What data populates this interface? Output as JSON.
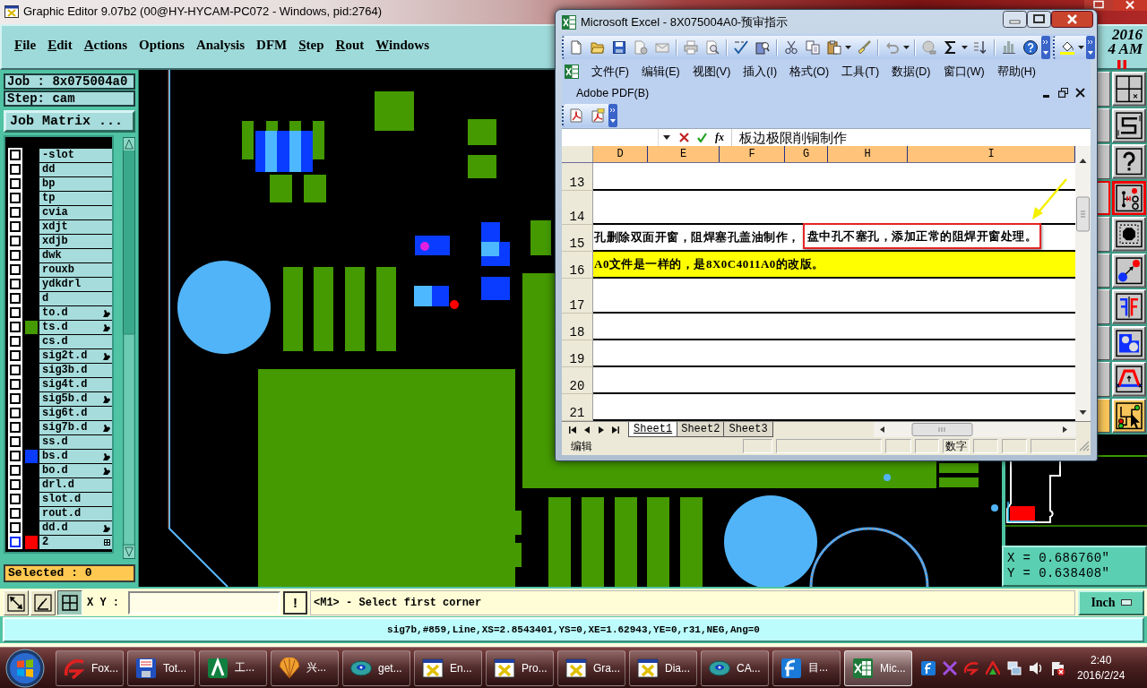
{
  "editor_window": {
    "title": "Graphic Editor 9.07b2 (00@HY-HYCAM-PC072 - Windows, pid:2764)",
    "menu": [
      {
        "label": "File",
        "mnemonic": true
      },
      {
        "label": "Edit",
        "mnemonic": true
      },
      {
        "label": "Actions",
        "mnemonic": true
      },
      {
        "label": "Options",
        "mnemonic": false
      },
      {
        "label": "Analysis",
        "mnemonic": false
      },
      {
        "label": "DFM",
        "mnemonic": false
      },
      {
        "label": "Step",
        "mnemonic": true
      },
      {
        "label": "Rout",
        "mnemonic": true
      },
      {
        "label": "Windows",
        "mnemonic": true
      }
    ],
    "clock": {
      "year": "2016",
      "time": "4 AM"
    },
    "job": "Job : 8x075004a0",
    "step": "Step: cam",
    "job_matrix_button": "Job Matrix ...",
    "layers": [
      {
        "name": "-slot",
        "checked": false,
        "marked": false,
        "current": false
      },
      {
        "name": "dd",
        "checked": false,
        "marked": false,
        "current": false
      },
      {
        "name": "bp",
        "checked": false,
        "marked": false,
        "current": false
      },
      {
        "name": "tp",
        "checked": false,
        "marked": false,
        "current": false
      },
      {
        "name": "cvia",
        "checked": false,
        "marked": false,
        "current": false
      },
      {
        "name": "xdjt",
        "checked": false,
        "marked": false,
        "current": false
      },
      {
        "name": "xdjb",
        "checked": false,
        "marked": false,
        "current": false
      },
      {
        "name": "dwk",
        "checked": false,
        "marked": false,
        "current": false
      },
      {
        "name": "rouxb",
        "checked": false,
        "marked": false,
        "current": false
      },
      {
        "name": "ydkdrl",
        "checked": false,
        "marked": false,
        "current": false
      },
      {
        "name": "d",
        "checked": false,
        "marked": false,
        "current": false
      },
      {
        "name": "to.d",
        "checked": false,
        "marked": true,
        "current": false
      },
      {
        "name": "ts.d",
        "checked": false,
        "marked": true,
        "current": false,
        "color": "#449a00"
      },
      {
        "name": "cs.d",
        "checked": false,
        "marked": false,
        "current": false
      },
      {
        "name": "sig2t.d",
        "checked": false,
        "marked": true,
        "current": false
      },
      {
        "name": "sig3b.d",
        "checked": false,
        "marked": false,
        "current": false
      },
      {
        "name": "sig4t.d",
        "checked": false,
        "marked": false,
        "current": false
      },
      {
        "name": "sig5b.d",
        "checked": false,
        "marked": true,
        "current": false
      },
      {
        "name": "sig6t.d",
        "checked": false,
        "marked": false,
        "current": false
      },
      {
        "name": "sig7b.d",
        "checked": false,
        "marked": true,
        "current": false
      },
      {
        "name": "ss.d",
        "checked": false,
        "marked": false,
        "current": false
      },
      {
        "name": "bs.d",
        "checked": false,
        "marked": true,
        "current": false,
        "color": "#0a3cff"
      },
      {
        "name": "bo.d",
        "checked": false,
        "marked": true,
        "current": false
      },
      {
        "name": "drl.d",
        "checked": false,
        "marked": false,
        "current": false
      },
      {
        "name": "slot.d",
        "checked": false,
        "marked": false,
        "current": false
      },
      {
        "name": "rout.d",
        "checked": false,
        "marked": false,
        "current": false
      },
      {
        "name": "dd.d",
        "checked": false,
        "marked": true,
        "current": false
      },
      {
        "name": "2",
        "checked": false,
        "marked": false,
        "current": true,
        "color": "#ff0000"
      }
    ],
    "selected_count": "Selected : 0",
    "tools": [
      {
        "selected": false,
        "marked": false
      },
      {
        "selected": false,
        "marked": false
      },
      {
        "selected": false,
        "marked": false
      },
      {
        "selected": false,
        "marked": true
      },
      {
        "selected": false,
        "marked": false
      },
      {
        "selected": false,
        "marked": false
      },
      {
        "selected": false,
        "marked": false
      },
      {
        "selected": false,
        "marked": false
      },
      {
        "selected": false,
        "marked": false
      },
      {
        "selected": true,
        "marked": false
      }
    ],
    "coordinates": {
      "x": "X = 0.686760\"",
      "y": "Y = 0.638408\""
    },
    "command_bar": {
      "toggles": [
        {
          "on": false
        },
        {
          "on": false
        },
        {
          "on": true
        }
      ],
      "label": "X Y :",
      "alert_button": "!",
      "prompt": "<M1> - Select first corner",
      "units_button": "Inch"
    },
    "status_line": "sig7b,#859,Line,XS=2.8543401,YS=0,XE=1.62943,YE=0,r31,NEG,Ang=0"
  },
  "excel_window": {
    "title": "Microsoft Excel - 8X075004A0-预审指示",
    "menu": [
      "文件(F)",
      "编辑(E)",
      "视图(V)",
      "插入(I)",
      "格式(O)",
      "工具(T)",
      "数据(D)",
      "窗口(W)",
      "帮助(H)"
    ],
    "adobe_menu": "Adobe PDF(B)",
    "formula_bar": {
      "function_button": "fx",
      "value": "板边极限削铜制作"
    },
    "columns": [
      "D",
      "E",
      "F",
      "G",
      "H",
      "I"
    ],
    "rows": [
      {
        "number": "13"
      },
      {
        "number": "14"
      },
      {
        "number": "15",
        "segments": [
          {
            "text": "孔删除双面开窗，阻焊塞孔盖油制作，",
            "boxed": false
          },
          {
            "text": "盘中孔不塞孔，添加正常的阻焊开窗处理。",
            "boxed": true
          }
        ]
      },
      {
        "number": "16",
        "color": "#ffff00",
        "segments": [
          {
            "text": "A0文件是一样的，是8X0C4011A0的改版。",
            "boxed": false
          }
        ]
      },
      {
        "number": "17"
      },
      {
        "number": "18"
      },
      {
        "number": "19"
      },
      {
        "number": "20"
      },
      {
        "number": "21"
      }
    ],
    "sheets": [
      {
        "label": "Sheet1",
        "selected": true
      },
      {
        "label": "Sheet2",
        "selected": false
      },
      {
        "label": "Sheet3",
        "selected": false
      }
    ],
    "status_bar": {
      "mode": "编辑",
      "indicator": "数字"
    }
  },
  "taskbar": {
    "items": [
      {
        "label": "Fox...",
        "selected": false
      },
      {
        "label": "Tot...",
        "selected": false
      },
      {
        "label": "工...",
        "selected": false
      },
      {
        "label": "兴...",
        "selected": false
      },
      {
        "label": "get...",
        "selected": false
      },
      {
        "label": "En...",
        "selected": false
      },
      {
        "label": "Pro...",
        "selected": false
      },
      {
        "label": "Gra...",
        "selected": false
      },
      {
        "label": "Dia...",
        "selected": false
      },
      {
        "label": "CA...",
        "selected": false
      },
      {
        "label": "目...",
        "selected": false
      },
      {
        "label": "Mic...",
        "selected": true
      }
    ],
    "clock": {
      "time": "2:40",
      "date": "2016/2/24"
    }
  }
}
